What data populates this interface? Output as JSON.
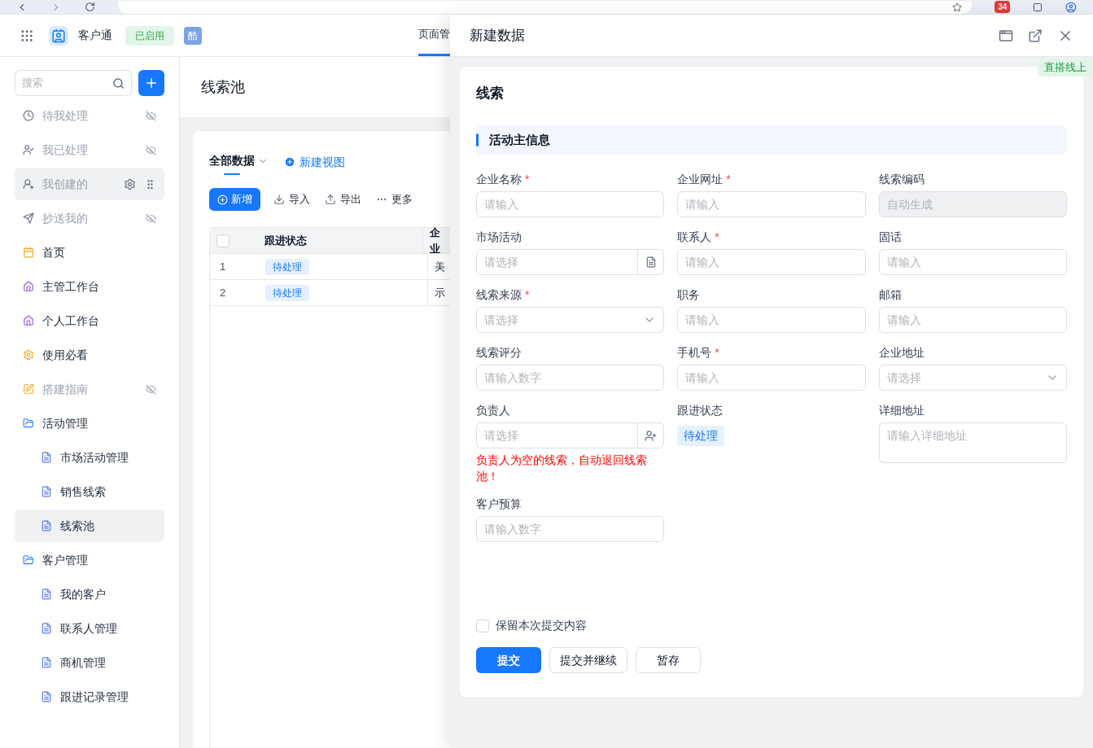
{
  "browser": {
    "badge": "34"
  },
  "header": {
    "app_name": "客户通",
    "status_tag": "已启用",
    "avatar_char": "酷",
    "nav_tab": "页面管"
  },
  "sidebar": {
    "search_placeholder": "搜索",
    "items": [
      {
        "label": "待我处理",
        "hidden": true,
        "dimmed": true,
        "selected": false
      },
      {
        "label": "我已处理",
        "hidden": true,
        "dimmed": true,
        "selected": false
      },
      {
        "label": "我创建的",
        "hidden": false,
        "dimmed": true,
        "selected": true
      },
      {
        "label": "抄送我的",
        "hidden": true,
        "dimmed": true,
        "selected": false
      },
      {
        "label": "首页",
        "hidden": false,
        "dimmed": false,
        "selected": false
      },
      {
        "label": "主管工作台",
        "hidden": false,
        "dimmed": false,
        "selected": false
      },
      {
        "label": "个人工作台",
        "hidden": false,
        "dimmed": false,
        "selected": false
      },
      {
        "label": "使用必看",
        "hidden": false,
        "dimmed": false,
        "selected": false
      },
      {
        "label": "搭建指南",
        "hidden": true,
        "dimmed": true,
        "selected": false
      },
      {
        "label": "活动管理",
        "hidden": false,
        "dimmed": false,
        "selected": false,
        "children": [
          {
            "label": "市场活动管理",
            "selected": false
          },
          {
            "label": "销售线索",
            "selected": false
          },
          {
            "label": "线索池",
            "selected": true
          }
        ]
      },
      {
        "label": "客户管理",
        "hidden": false,
        "dimmed": false,
        "selected": false,
        "children": [
          {
            "label": "我的客户",
            "selected": false
          },
          {
            "label": "联系人管理",
            "selected": false
          },
          {
            "label": "商机管理",
            "selected": false
          },
          {
            "label": "跟进记录管理",
            "selected": false
          }
        ]
      }
    ]
  },
  "page": {
    "title": "线索池",
    "views": [
      {
        "label": "全部数据",
        "selected": true
      }
    ],
    "new_view": "新建视图",
    "toolbar": [
      {
        "kind": "primary",
        "label": "新增"
      },
      {
        "kind": "import",
        "label": "导入"
      },
      {
        "kind": "export",
        "label": "导出"
      },
      {
        "kind": "more",
        "label": "更多"
      }
    ],
    "table": {
      "select_all_checked": false,
      "columns": [
        "跟进状态",
        "企业"
      ],
      "rows": [
        {
          "index": "1",
          "status": "待处理",
          "column_2": "美"
        },
        {
          "index": "2",
          "status": "待处理",
          "column_2": "示"
        }
      ]
    }
  },
  "drawer": {
    "title": "新建数据",
    "corner_tag": "直搭线上",
    "form_title": "线索",
    "section": "活动主信息",
    "fields": [
      {
        "label": "企业名称",
        "required_mark": "*",
        "kind": "input",
        "placeholder": "请输入"
      },
      {
        "label": "企业网址",
        "required_mark": "*",
        "kind": "input",
        "placeholder": "请输入"
      },
      {
        "label": "线索编码",
        "kind": "disabled",
        "placeholder": "自动生成"
      },
      {
        "label": "市场活动",
        "kind": "picker",
        "placeholder": "请选择"
      },
      {
        "label": "联系人",
        "required_mark": "*",
        "kind": "input",
        "placeholder": "请输入"
      },
      {
        "label": "固话",
        "kind": "input",
        "placeholder": "请输入"
      },
      {
        "label": "线索来源",
        "required_mark": "*",
        "kind": "select",
        "placeholder": "请选择"
      },
      {
        "label": "职务",
        "kind": "input",
        "placeholder": "请输入"
      },
      {
        "label": "邮箱",
        "kind": "input",
        "placeholder": "请输入"
      },
      {
        "label": "线索评分",
        "kind": "input",
        "placeholder": "请输入数字"
      },
      {
        "label": "手机号",
        "required_mark": "*",
        "kind": "input",
        "placeholder": "请输入"
      },
      {
        "label": "企业地址",
        "kind": "select",
        "placeholder": "请选择"
      },
      {
        "label": "负责人",
        "kind": "user",
        "placeholder": "请选择",
        "error": "负责人为空的线索，自动退回线索池！"
      },
      {
        "label": "跟进状态",
        "kind": "tag",
        "value": "待处理"
      },
      {
        "label": "详细地址",
        "kind": "textarea",
        "placeholder": "请输入详细地址"
      },
      {
        "label": "客户预算",
        "kind": "input",
        "placeholder": "请输入数字"
      }
    ],
    "keep": {
      "label": "保留本次提交内容",
      "checked": false
    },
    "buttons": [
      {
        "kind": "primary",
        "label": "提交"
      },
      {
        "kind": "default",
        "label": "提交并继续"
      },
      {
        "kind": "default",
        "label": "暂存"
      }
    ]
  }
}
